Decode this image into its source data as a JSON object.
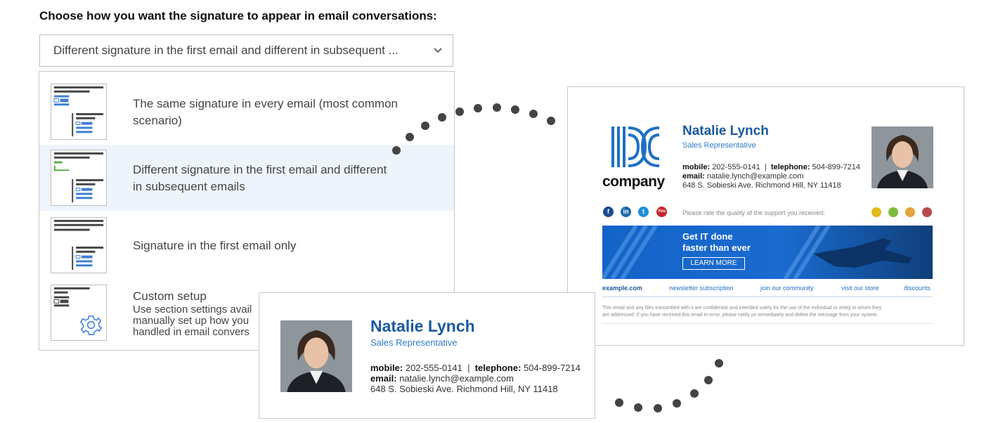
{
  "heading": "Choose how you want the signature to appear in email conversations:",
  "select": {
    "value": "Different signature in the first email and different in subsequent ..."
  },
  "options": [
    {
      "line1": "The same signature in every email (most common",
      "line2": "scenario)"
    },
    {
      "line1": "Different signature in the first email and different",
      "line2": "in subsequent emails"
    },
    {
      "line1": "Signature in the first email only",
      "line2": ""
    },
    {
      "line1": "Custom setup",
      "desc1": "Use section settings avail",
      "desc2": "manually set up how you",
      "desc3": "handled in email convers"
    }
  ],
  "selected_option_index": 1,
  "signature_full": {
    "logo_text": "company",
    "name": "Natalie Lynch",
    "title": "Sales Representative",
    "mobile_label": "mobile:",
    "mobile": "202-555-0141",
    "separator": "|",
    "telephone_label": "telephone:",
    "telephone": "504-899-7214",
    "email_label": "email:",
    "email": "natalie.lynch@example.com",
    "address": "648 S. Sobieski Ave. Richmond Hill, NY 11418",
    "rating_prompt": "Please rate the quality of the support you received:",
    "social_icons": [
      "facebook-icon",
      "linkedin-icon",
      "twitter-icon",
      "youtube-icon"
    ],
    "banner": {
      "line1": "Get IT done",
      "line2": "faster than ever",
      "button": "LEARN MORE"
    },
    "links": [
      "example.com",
      "newsletter subscription",
      "join our community",
      "visit our store",
      "discounts"
    ],
    "disclaimer1": "This email and any files transmitted with it are confidential and intended solely for the use of the individual or entity to whom they",
    "disclaimer2": "are addressed. If you have received this email in error, please notify us immediately and delete the message from your system."
  },
  "signature_short": {
    "name": "Natalie Lynch",
    "title": "Sales Representative",
    "mobile_label": "mobile:",
    "mobile": "202-555-0141",
    "separator": "|",
    "telephone_label": "telephone:",
    "telephone": "504-899-7214",
    "email_label": "email:",
    "email": "natalie.lynch@example.com",
    "address": "648 S. Sobieski Ave. Richmond Hill, NY 11418"
  },
  "colors": {
    "accent": "#1a5a9e",
    "link": "#2273c3",
    "selected_bg": "#eef4fb",
    "thumb_blue": "#3d7fd6",
    "thumb_green": "#5aaa3c",
    "dot": "#444444"
  }
}
